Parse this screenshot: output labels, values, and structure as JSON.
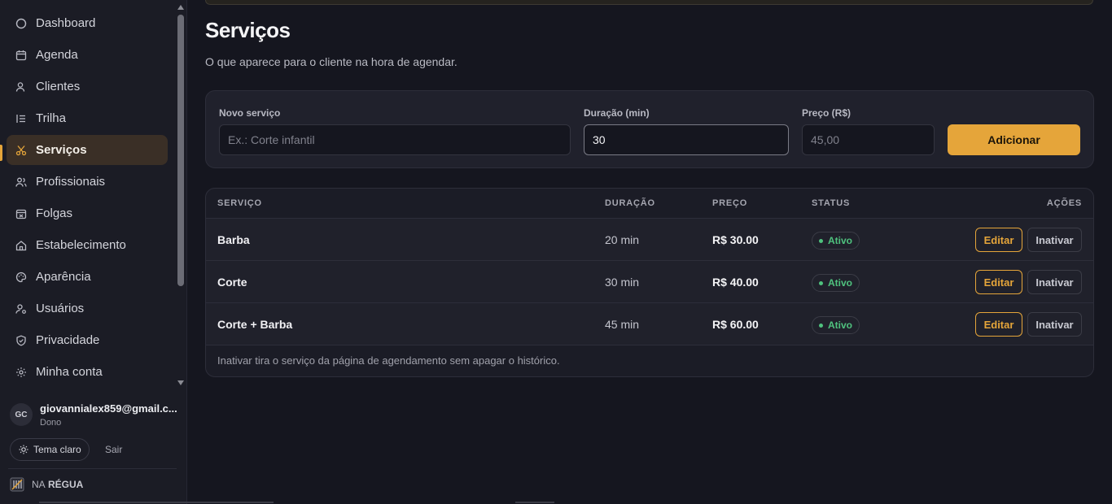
{
  "sidebar": {
    "items": [
      {
        "label": "Dashboard",
        "icon": "circle-icon"
      },
      {
        "label": "Agenda",
        "icon": "calendar-icon"
      },
      {
        "label": "Clientes",
        "icon": "user-icon"
      },
      {
        "label": "Trilha",
        "icon": "list-icon"
      },
      {
        "label": "Serviços",
        "icon": "scissors-icon"
      },
      {
        "label": "Profissionais",
        "icon": "users-icon"
      },
      {
        "label": "Folgas",
        "icon": "calendar-off-icon"
      },
      {
        "label": "Estabelecimento",
        "icon": "home-icon"
      },
      {
        "label": "Aparência",
        "icon": "palette-icon"
      },
      {
        "label": "Usuários",
        "icon": "user-cog-icon"
      },
      {
        "label": "Privacidade",
        "icon": "shield-icon"
      },
      {
        "label": "Minha conta",
        "icon": "sun-gear-icon"
      }
    ],
    "active_index": 4,
    "user": {
      "initials": "GC",
      "email": "giovannialex859@gmail.c...",
      "role": "Dono"
    },
    "theme_toggle_label": "Tema claro",
    "logout_label": "Sair",
    "brand": {
      "name_part1": "NA",
      "name_part2": "RÉGUA"
    }
  },
  "page": {
    "title": "Serviços",
    "subtitle": "O que aparece para o cliente na hora de agendar."
  },
  "form": {
    "name_label": "Novo serviço",
    "name_placeholder": "Ex.: Corte infantil",
    "duration_label": "Duração (min)",
    "duration_value": "30",
    "price_label": "Preço (R$)",
    "price_placeholder": "45,00",
    "add_label": "Adicionar"
  },
  "table": {
    "headers": {
      "service": "SERVIÇO",
      "duration": "DURAÇÃO",
      "price": "PREÇO",
      "status": "STATUS",
      "actions": "AÇÕES"
    },
    "rows": [
      {
        "name": "Barba",
        "duration": "20 min",
        "price": "R$ 30.00",
        "status": "Ativo",
        "edit": "Editar",
        "deactivate": "Inativar"
      },
      {
        "name": "Corte",
        "duration": "30 min",
        "price": "R$ 40.00",
        "status": "Ativo",
        "edit": "Editar",
        "deactivate": "Inativar"
      },
      {
        "name": "Corte + Barba",
        "duration": "45 min",
        "price": "R$ 60.00",
        "status": "Ativo",
        "edit": "Editar",
        "deactivate": "Inativar"
      }
    ],
    "note": "Inativar tira o serviço da página de agendamento sem apagar o histórico."
  },
  "colors": {
    "accent": "#e5a53a",
    "status_active": "#4fc27e",
    "background": "#15161f"
  }
}
